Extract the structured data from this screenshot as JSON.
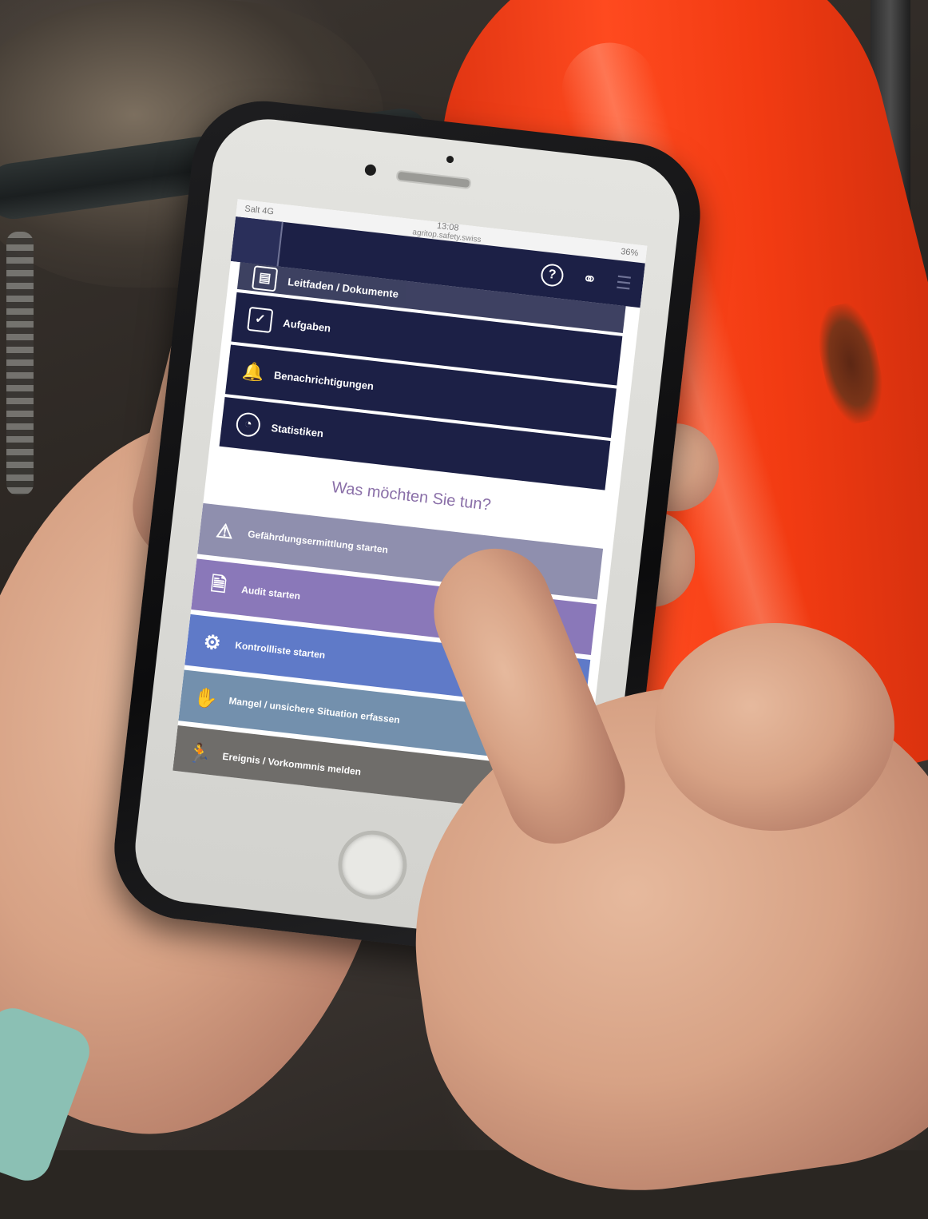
{
  "status_bar": {
    "carrier": "Salt 4G",
    "time": "13:08",
    "url": "agritop.safety.swiss",
    "battery": "36%"
  },
  "header": {
    "help_icon": "help-circle-icon",
    "share_icon": "share-icon",
    "menu_icon": "hamburger-menu-icon"
  },
  "nav": {
    "items": [
      {
        "label": "Leitfaden / Dokumente",
        "icon": "document-icon"
      },
      {
        "label": "Aufgaben",
        "icon": "checkbox-icon"
      },
      {
        "label": "Benachrichtigungen",
        "icon": "bell-icon"
      },
      {
        "label": "Statistiken",
        "icon": "pie-chart-icon"
      }
    ]
  },
  "prompt": "Was möchten Sie tun?",
  "actions": [
    {
      "label": "Gefährdungsermittlung starten",
      "icon": "warning-icon",
      "color": "#8f8fae"
    },
    {
      "label": "Audit starten",
      "icon": "audit-document-icon",
      "color": "#8a78b9"
    },
    {
      "label": "Kontrollliste starten",
      "icon": "robot-arm-icon",
      "color": "#5f7ac8"
    },
    {
      "label": "Mangel / unsichere Situation erfassen",
      "icon": "hand-alert-icon",
      "color": "#7390ad"
    },
    {
      "label": "Ereignis / Vorkommnis melden",
      "icon": "falling-person-icon",
      "color": "#6f6d6a"
    }
  ]
}
